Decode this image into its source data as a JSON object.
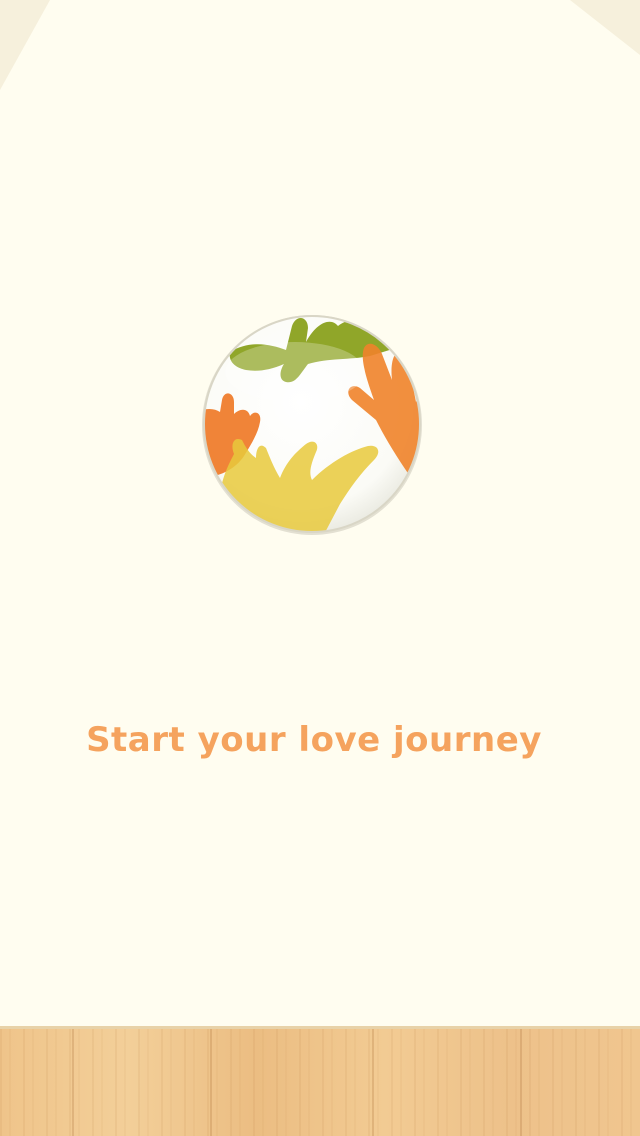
{
  "splash": {
    "tagline": "Start your love journey",
    "logo_icon": "hands-globe-icon"
  },
  "colors": {
    "background": "#fffdf0",
    "tagline": "#f5a35e",
    "hand_green": "#8aa11e",
    "hand_orange": "#f0832a",
    "hand_yellow": "#e8c93c",
    "floor_wood": "#efc48a"
  }
}
